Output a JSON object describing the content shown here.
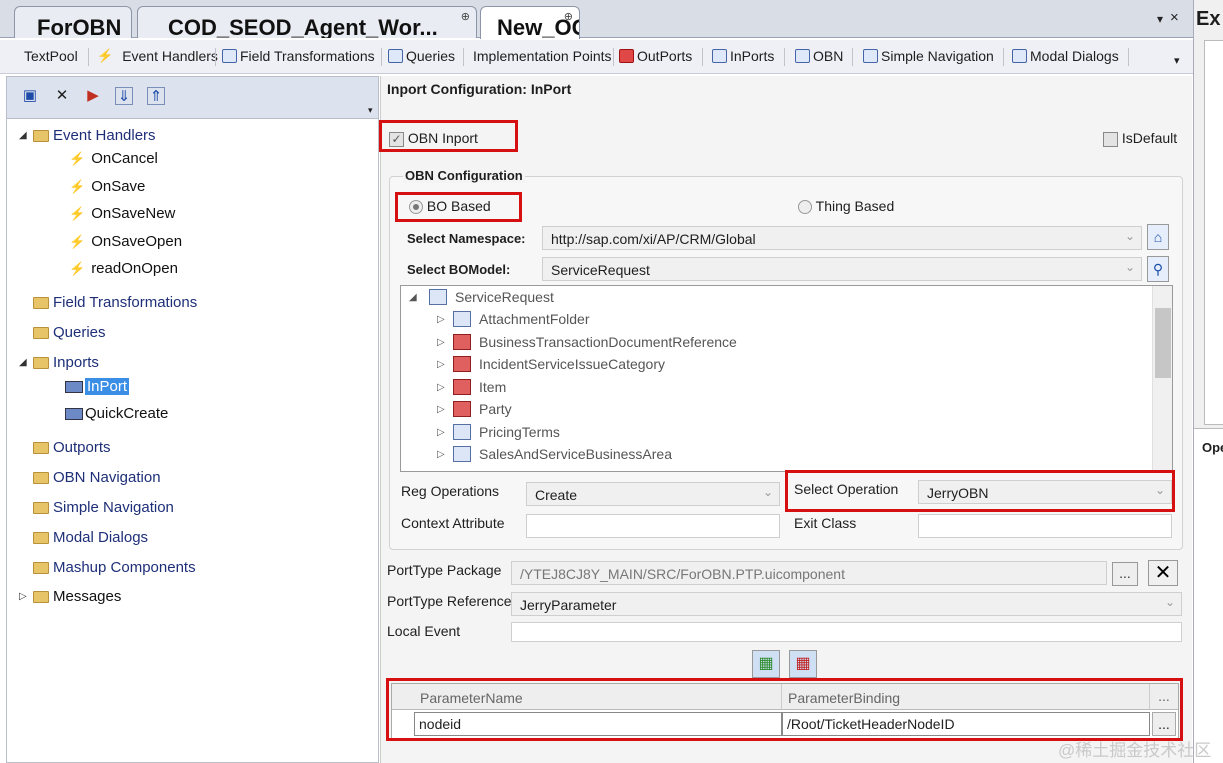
{
  "document_tabs": [
    {
      "label": "ForOBN",
      "active": false
    },
    {
      "label": "COD_SEOD_Agent_Wor...",
      "active": false
    },
    {
      "label": "New_OC",
      "active": true
    }
  ],
  "tab_controls": {
    "dropdown": "▾",
    "close": "×"
  },
  "side_panel": {
    "header": "Ex",
    "ops_label": "Ope"
  },
  "sub_tabs": [
    {
      "label": "TextPool",
      "icon": "none"
    },
    {
      "label": "Event Handlers",
      "icon": "lightning-icon"
    },
    {
      "label": "Field Transformations",
      "icon": "transform-icon"
    },
    {
      "label": "Queries",
      "icon": "query-icon"
    },
    {
      "label": "Implementation Points",
      "icon": "none"
    },
    {
      "label": "OutPorts",
      "icon": "outport-icon"
    },
    {
      "label": "InPorts",
      "icon": "inport-icon"
    },
    {
      "label": "OBN",
      "icon": "obn-icon"
    },
    {
      "label": "Simple Navigation",
      "icon": "navigation-icon"
    },
    {
      "label": "Modal Dialogs",
      "icon": "dialog-icon"
    }
  ],
  "tree": {
    "event_handlers": {
      "label": "Event Handlers",
      "children": [
        "OnCancel",
        "OnSave",
        "OnSaveNew",
        "OnSaveOpen",
        "readOnOpen"
      ]
    },
    "field_transformations": "Field Transformations",
    "queries": "Queries",
    "inports": {
      "label": "Inports",
      "children": [
        "InPort",
        "QuickCreate"
      ],
      "selected": "InPort"
    },
    "outports": "Outports",
    "obn_navigation": "OBN Navigation",
    "simple_navigation": "Simple Navigation",
    "modal_dialogs": "Modal Dialogs",
    "mashup_components": "Mashup Components",
    "messages": "Messages"
  },
  "config": {
    "title": "Inport Configuration: InPort",
    "obn_inport": {
      "label": "OBN Inport",
      "checked": true
    },
    "is_default": {
      "label": "IsDefault",
      "checked": false
    },
    "obn_group_title": "OBN Configuration",
    "bo_based": {
      "label": "BO Based",
      "selected": true
    },
    "thing_based": {
      "label": "Thing Based",
      "selected": false
    },
    "namespace": {
      "label": "Select Namespace:",
      "value": "http://sap.com/xi/AP/CRM/Global"
    },
    "bo_model": {
      "label": "Select BOModel:",
      "value": "ServiceRequest"
    },
    "bo_tree": {
      "root": "ServiceRequest",
      "children": [
        "AttachmentFolder",
        "BusinessTransactionDocumentReference",
        "IncidentServiceIssueCategory",
        "Item",
        "Party",
        "PricingTerms",
        "SalesAndServiceBusinessArea"
      ]
    },
    "reg_operations": {
      "label": "Reg Operations",
      "value": "Create"
    },
    "select_operation": {
      "label": "Select Operation",
      "value": "JerryOBN"
    },
    "context_attribute": {
      "label": "Context Attribute",
      "value": ""
    },
    "exit_class": {
      "label": "Exit Class",
      "value": ""
    },
    "porttype_package": {
      "label": "PortType Package",
      "value": "/YTEJ8CJ8Y_MAIN/SRC/ForOBN.PTP.uicomponent",
      "browse": "..."
    },
    "porttype_reference": {
      "label": "PortType Reference",
      "value": "JerryParameter"
    },
    "local_event": {
      "label": "Local Event",
      "value": ""
    },
    "grid": {
      "columns": [
        "ParameterName",
        "ParameterBinding"
      ],
      "rows": [
        {
          "name": "nodeid",
          "binding": "/Root/TicketHeaderNodeID"
        }
      ],
      "ellipsis": "..."
    }
  },
  "watermark": "@稀土掘金技术社区",
  "colors": {
    "highlight_box": "#d61010",
    "selection": "#3a8ee6",
    "tree_text": "#1e2f78"
  }
}
